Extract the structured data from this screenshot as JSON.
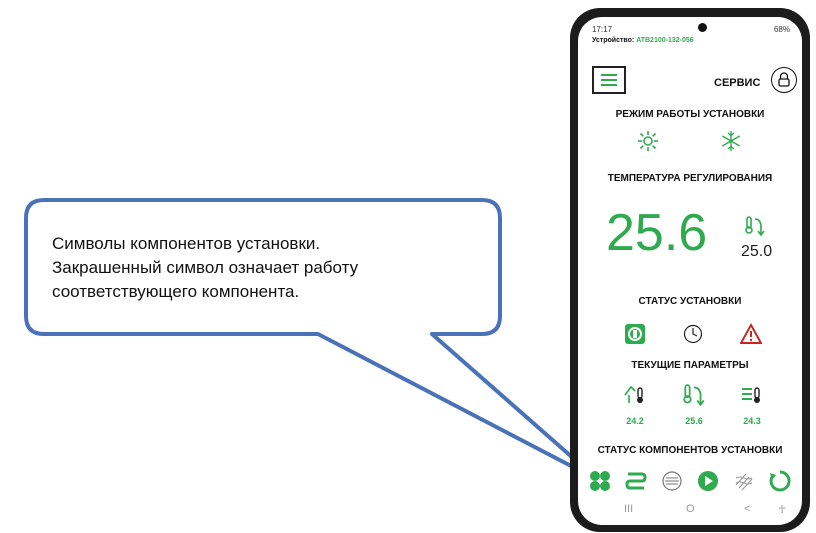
{
  "callout": {
    "lines": [
      "Символы компонентов установки.",
      "Закрашенный символ означает работу",
      "соответствующего компонента."
    ]
  },
  "phone": {
    "status_bar": {
      "time": "17:17",
      "right": "68%"
    },
    "device": {
      "label": "Устройство:",
      "id": "ATB2100-132-056"
    },
    "header": {
      "service_label": "СЕРВИС"
    },
    "mode_title": "РЕЖИМ РАБОТЫ УСТАНОВКИ",
    "temp_title": "ТЕМПЕРАТУРА РЕГУЛИРОВАНИЯ",
    "current_temp": "25.6",
    "setpoint": "25.0",
    "status_title": "СТАТУС УСТАНОВКИ",
    "params_title": "ТЕКУЩИЕ ПАРАМЕТРЫ",
    "params": [
      "24.2",
      "25.6",
      "24.3"
    ],
    "components_title": "СТАТУС КОМПОНЕНТОВ УСТАНОВКИ",
    "navbar": [
      "III",
      "O",
      "<",
      "☥"
    ]
  },
  "colors": {
    "accent": "#2eaa4f",
    "alarm": "#c62828",
    "callout_border": "#4a72b8"
  },
  "icons": {
    "mode": [
      "sun-heating-icon",
      "snowflake-cooling-icon"
    ],
    "status": [
      "power-icon",
      "clock-icon",
      "warning-icon"
    ],
    "params": [
      "outdoor-temp-icon",
      "supply-temp-icon",
      "return-temp-icon"
    ],
    "components": [
      "fan-icon",
      "heater-coil-icon",
      "filter-icon",
      "pump-icon",
      "cooler-icon",
      "recuperator-icon"
    ]
  }
}
